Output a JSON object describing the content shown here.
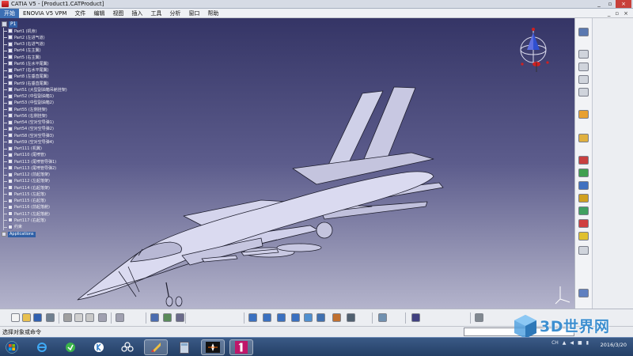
{
  "window": {
    "title": "CATIA V5 - [Product1.CATProduct]"
  },
  "menu": {
    "items": [
      "开始",
      "ENOVIA V5 VPM",
      "文件",
      "编辑",
      "视图",
      "插入",
      "工具",
      "分析",
      "窗口",
      "帮助"
    ],
    "window_controls": [
      "_",
      "▫",
      "×"
    ]
  },
  "tree": {
    "root_label": "P1",
    "nodes": [
      "Part1 (机身)",
      "Part2 (左进气道)",
      "Part3 (右进气道)",
      "Part4 (左主翼)",
      "Part5 (右主翼)",
      "Part6 (左水平尾翼)",
      "Part7 (右水平尾翼)",
      "Part8 (左垂直尾翼)",
      "Part9 (右垂直尾翼)",
      "Part51 (大型副油箱吊舱挂架)",
      "Part52 (中型副油箱1)",
      "Part53 (中型副油箱2)",
      "Part55 (左侧挂架)",
      "Part56 (右侧挂架)",
      "Part54 (空对空导弹1)",
      "Part54 (空对空导弹2)",
      "Part58 (空对空导弹3)",
      "Part59 (空对空导弹4)",
      "Part111 (机翼)",
      "Part110 (尾喷管)",
      "Part113 (尾喷管导弹1)",
      "Part113 (尾喷管导弹2)",
      "Part112 (前起落架)",
      "Part112 (左起落架)",
      "Part114 (右起落架)",
      "Part115 (左起落)",
      "Part115 (右起落)",
      "Part116 (前起落舱)",
      "Part117 (左起落舱)",
      "Part117 (右起落)",
      "约束"
    ],
    "applications_label": "Applications"
  },
  "status": {
    "text": "选择对象或命令"
  },
  "watermark": {
    "text": "3D世界网"
  },
  "taskbar": {
    "date": "2016/3/20",
    "tray": [
      "CH"
    ]
  },
  "colors": {
    "menu_active": "#3c6fb4",
    "viewport_top": "#353566",
    "viewport_bottom": "#b4b4cc",
    "aircraft_fill": "#d8d8ee",
    "compass_red": "#d02020",
    "compass_blue": "#3050d0",
    "close_button": "#c8403a"
  },
  "icons": {
    "right_toolbar": [
      "sketch-icon",
      "pad-icon",
      "pocket-icon",
      "shaft-icon",
      "groove-icon",
      "select-icon",
      "symbol-icon",
      "assembly-icon",
      "component-icon",
      "part-icon",
      "insert-icon",
      "replace-icon",
      "move-icon",
      "explode-icon",
      "constraint-icon",
      "update-icon"
    ],
    "bottom_toolbar": [
      "new-icon",
      "open-icon",
      "save-icon",
      "print-icon",
      "cut-icon",
      "copy-icon",
      "paste-icon",
      "undo-icon",
      "redo-icon",
      "formula-icon",
      "help-icon",
      "fly-icon",
      "pan-icon",
      "rotate-icon",
      "zoom-in-icon",
      "zoom-out-icon",
      "normal-view-icon",
      "iso-view-icon",
      "render-icon",
      "hide-icon",
      "swap-icon",
      "measure-icon",
      "catalog-icon"
    ]
  }
}
